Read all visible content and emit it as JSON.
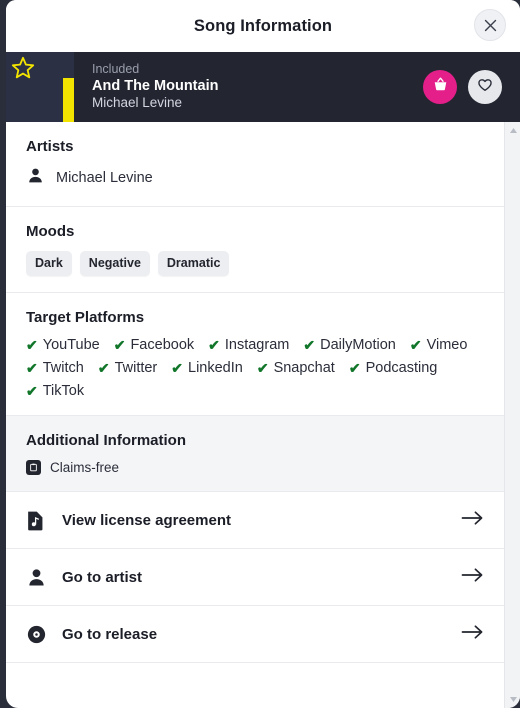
{
  "dialog": {
    "title": "Song Information",
    "close_label": "×",
    "close_icon": "close-icon"
  },
  "now_playing": {
    "badge_label": "Included",
    "track_title": "And The Mountain",
    "artist": "Michael Levine",
    "play_icon": "play-icon",
    "star_icon": "star-icon",
    "cart_icon": "basket-icon",
    "like_icon": "heart-icon",
    "colors": {
      "strip_bg": "#232631",
      "art_bg": "#2b3044",
      "star": "#f2e400",
      "cart": "#e41f8a",
      "like": "#e6e8ec"
    }
  },
  "artists": {
    "heading": "Artists",
    "icon": "person-icon",
    "items": [
      {
        "name": "Michael Levine"
      }
    ]
  },
  "moods": {
    "heading": "Moods",
    "items": [
      "Dark",
      "Negative",
      "Dramatic"
    ]
  },
  "target_platforms": {
    "heading": "Target Platforms",
    "check_glyph": "✔",
    "check_color": "#11762a",
    "items": [
      "YouTube",
      "Facebook",
      "Instagram",
      "DailyMotion",
      "Vimeo",
      "Twitch",
      "Twitter",
      "LinkedIn",
      "Snapchat",
      "Podcasting",
      "TikTok"
    ]
  },
  "additional_information": {
    "heading": "Additional Information",
    "items": [
      {
        "label": "Claims-free",
        "icon": "claims-free-badge-icon"
      }
    ]
  },
  "actions": [
    {
      "label": "View license agreement",
      "icon": "license-document-icon",
      "arrow": "arrow-right-icon"
    },
    {
      "label": "Go to artist",
      "icon": "person-icon",
      "arrow": "arrow-right-icon"
    },
    {
      "label": "Go to release",
      "icon": "vinyl-record-icon",
      "arrow": "arrow-right-icon"
    }
  ],
  "scrollbar": {
    "up_icon": "scroll-up-arrow-icon",
    "down_icon": "scroll-down-arrow-icon"
  }
}
